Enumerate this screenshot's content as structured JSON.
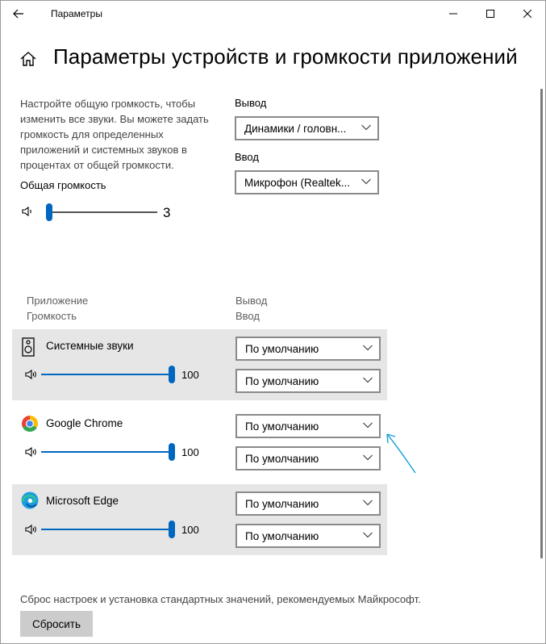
{
  "window": {
    "title": "Параметры"
  },
  "page": {
    "title": "Параметры устройств и громкости приложений"
  },
  "description": "Настройте общую громкость, чтобы изменить все звуки. Вы можете задать громкость для определенных приложений и системных звуков в процентах от общей громкости.",
  "master": {
    "label": "Общая громкость",
    "value": "3",
    "level_percent": 3
  },
  "output": {
    "label": "Вывод",
    "value": "Динамики / головн..."
  },
  "input": {
    "label": "Ввод",
    "value": "Микрофон (Realtek..."
  },
  "columns": {
    "app": "Приложение",
    "volume": "Громкость",
    "output": "Вывод",
    "input": "Ввод"
  },
  "apps": [
    {
      "name": "Системные звуки",
      "volume": "100",
      "level_percent": 100,
      "output": "По умолчанию",
      "input": "По умолчанию",
      "icon": "system-sounds-icon"
    },
    {
      "name": "Google Chrome",
      "volume": "100",
      "level_percent": 100,
      "output": "По умолчанию",
      "input": "По умолчанию",
      "icon": "chrome-icon"
    },
    {
      "name": "Microsoft Edge",
      "volume": "100",
      "level_percent": 100,
      "output": "По умолчанию",
      "input": "По умолчанию",
      "icon": "edge-icon"
    }
  ],
  "reset": {
    "text": "Сброс настроек и установка стандартных значений, рекомендуемых Майкрософт.",
    "button": "Сбросить"
  },
  "colors": {
    "accent": "#0067c0",
    "row_bg": "#e6e6e6",
    "annotation": "#1a9fd8"
  }
}
